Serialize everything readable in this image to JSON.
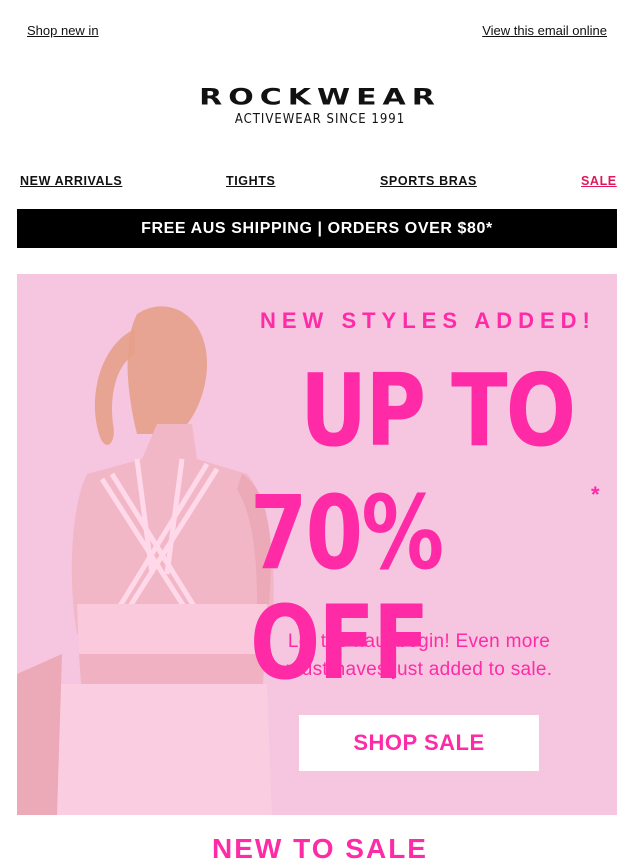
{
  "top": {
    "shop_new_in": "Shop new in",
    "view_online": "View this email online"
  },
  "brand": {
    "name": "ROCKWEAR",
    "tagline": "ACTIVEWEAR SINCE 1991"
  },
  "nav": {
    "new_arrivals": "NEW ARRIVALS",
    "tights": "TIGHTS",
    "sports_bras": "SPORTS BRAS",
    "sale": "SALE"
  },
  "shipping_banner": "FREE AUS SHIPPING | ORDERS OVER $80*",
  "hero": {
    "subtitle": "NEW STYLES ADDED!",
    "headline_line1": "UP TO",
    "headline_line2": "70% OFF",
    "asterisk": "*",
    "body": "Let the haul begin! Even more must-haves just added to sale.",
    "cta": "SHOP SALE"
  },
  "next_section_title": "NEW TO SALE",
  "colors": {
    "accent_pink": "#ff2aa6",
    "hero_bg": "#f6c5df",
    "sale_red": "#e0185b"
  }
}
